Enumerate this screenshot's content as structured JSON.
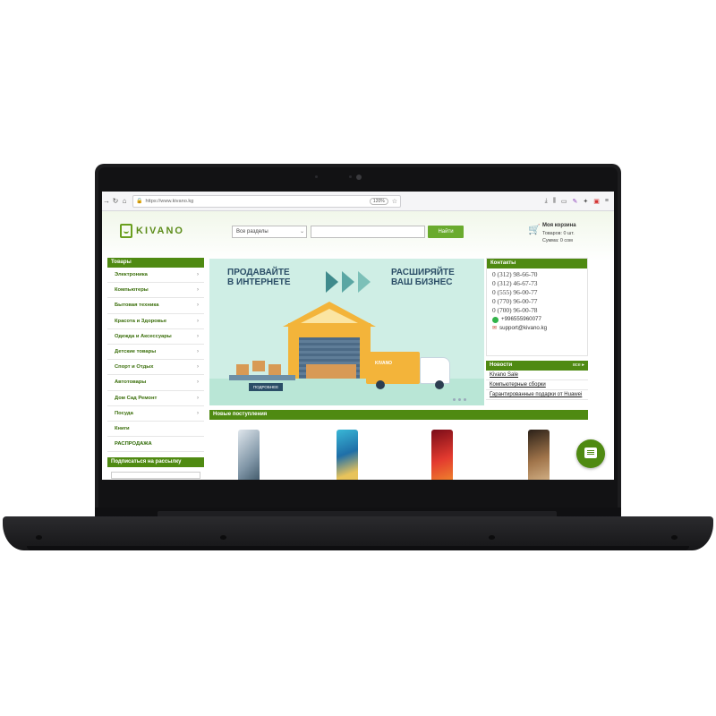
{
  "browser": {
    "url": "https://www.kivano.kg",
    "zoom": "120%"
  },
  "header": {
    "logo": "KIVANO",
    "search_select": "Все разделы",
    "search_button": "Найти",
    "cart_title": "Моя корзина",
    "cart_items": "Товаров: 0 шт.",
    "cart_sum": "Сумма: 0 сом"
  },
  "sidebar": {
    "title": "Товары",
    "items": [
      {
        "label": "Электроника",
        "arrow": true
      },
      {
        "label": "Компьютеры",
        "arrow": true
      },
      {
        "label": "Бытовая техника",
        "arrow": true
      },
      {
        "label": "Красота и Здоровье",
        "arrow": true
      },
      {
        "label": "Одежда и Аксессуары",
        "arrow": true
      },
      {
        "label": "Детские товары",
        "arrow": true
      },
      {
        "label": "Спорт и Отдых",
        "arrow": true
      },
      {
        "label": "Автотовары",
        "arrow": true
      },
      {
        "label": "Дом Сад Ремонт",
        "arrow": true
      },
      {
        "label": "Посуда",
        "arrow": true
      },
      {
        "label": "Книги",
        "arrow": false
      },
      {
        "label": "РАСПРОДАЖА",
        "arrow": false
      }
    ],
    "subscribe_title": "Подписаться на рассылку"
  },
  "banner": {
    "left_text": "ПРОДАВАЙТЕ\nВ ИНТЕРНЕТЕ",
    "right_text": "РАСШИРЯЙТЕ\nВАШ БИЗНЕС",
    "truck_label": "KIVANO",
    "plate": "ПОДРОБНЕЕ"
  },
  "contacts": {
    "title": "Контакты",
    "phones": [
      "0 (312) 98-66-70",
      "0 (312) 46-67-73",
      "0 (555) 96-00-77",
      "0 (770) 96-00-77",
      "0 (700) 96-00-78"
    ],
    "whatsapp": "+996555960077",
    "email": "support@kivano.kg"
  },
  "news": {
    "title": "Новости",
    "all": "все",
    "items": [
      "Kivano Sale",
      "Компьютерные сборки",
      "Гарантированные подарки от Huawei"
    ]
  },
  "arrivals": {
    "title": "Новые поступления"
  },
  "colors": {
    "brand_green": "#4f8a12",
    "button_green": "#6aab2e",
    "banner_bg": "#cfeee5"
  }
}
